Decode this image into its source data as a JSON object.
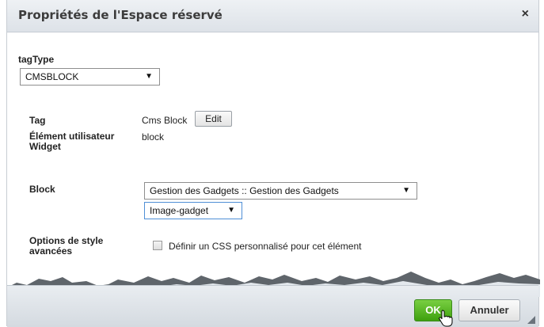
{
  "dialog": {
    "title": "Propriétés de l'Espace réservé",
    "close_label": "×"
  },
  "tagtype": {
    "label": "tagType",
    "selected": "CMSBLOCK"
  },
  "tag": {
    "label": "Tag",
    "value": "Cms Block",
    "edit_label": "Edit"
  },
  "widget": {
    "label": "Élément utilisateur Widget",
    "value": "block"
  },
  "block": {
    "label": "Block",
    "selected": "Gestion des Gadgets :: Gestion des Gadgets",
    "sub_selected": "Image-gadget"
  },
  "style": {
    "label": "Options de style avancées",
    "checkbox_label": "Définir un CSS personnalisé pour cet élément",
    "checked": false
  },
  "footer": {
    "ok_label": "OK",
    "cancel_label": "Annuler"
  },
  "colors": {
    "ok_button": "#4aad18",
    "titlebar": "#e4e8ec"
  }
}
